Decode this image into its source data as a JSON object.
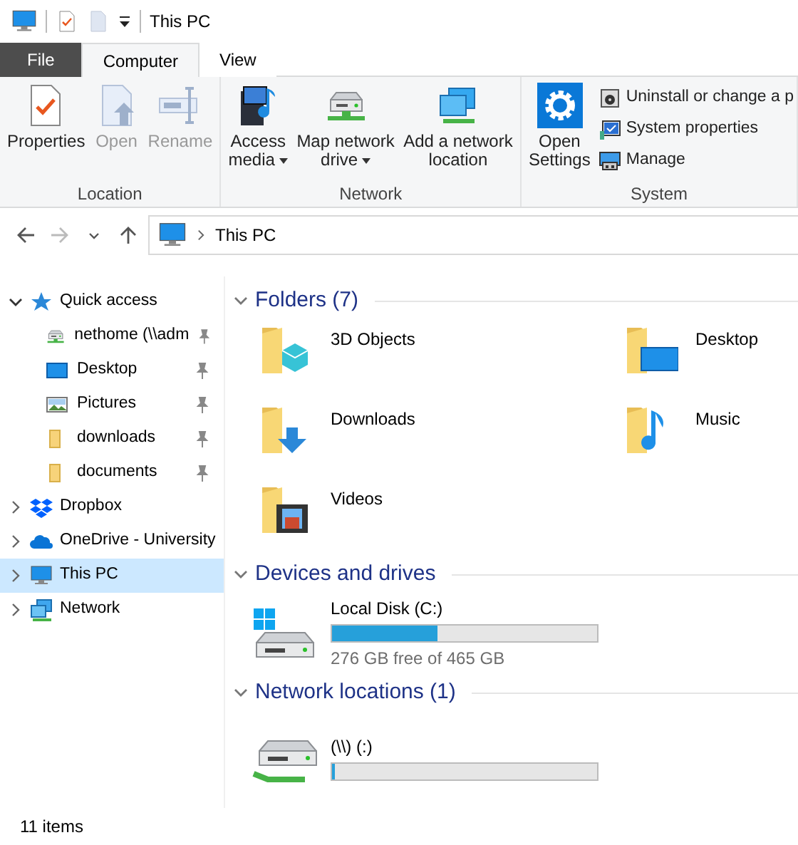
{
  "window": {
    "title": "This PC"
  },
  "tabs": [
    {
      "label": "File",
      "kind": "file",
      "selected": false
    },
    {
      "label": "Computer",
      "kind": "tab",
      "selected": true
    },
    {
      "label": "View",
      "kind": "tab",
      "selected": false
    }
  ],
  "ribbon": {
    "groups": [
      {
        "label": "Location",
        "buttons": [
          {
            "lines": [
              "Properties"
            ],
            "disabled": false,
            "dropdown": false
          },
          {
            "lines": [
              "Open"
            ],
            "disabled": true,
            "dropdown": false
          },
          {
            "lines": [
              "Rename"
            ],
            "disabled": true,
            "dropdown": false
          }
        ]
      },
      {
        "label": "Network",
        "buttons": [
          {
            "lines": [
              "Access",
              "media"
            ],
            "disabled": false,
            "dropdown": true
          },
          {
            "lines": [
              "Map network",
              "drive"
            ],
            "disabled": false,
            "dropdown": true
          },
          {
            "lines": [
              "Add a network",
              "location"
            ],
            "disabled": false,
            "dropdown": false
          }
        ]
      },
      {
        "label": "System",
        "buttons": [
          {
            "lines": [
              "Open",
              "Settings"
            ],
            "disabled": false,
            "dropdown": false
          }
        ],
        "small_buttons": [
          "Uninstall or change a p",
          "System properties",
          "Manage"
        ]
      }
    ]
  },
  "navigation": {
    "back_disabled": false,
    "forward_disabled": true,
    "address": "This PC"
  },
  "sidebar": {
    "items": [
      {
        "label": "Quick access",
        "expanded": true,
        "selected": false,
        "children": [
          {
            "label": "nethome (\\\\adm",
            "pinned": true,
            "selected": false
          },
          {
            "label": "Desktop",
            "pinned": true,
            "selected": false
          },
          {
            "label": "Pictures",
            "pinned": true,
            "selected": false
          },
          {
            "label": "downloads",
            "pinned": true,
            "selected": false
          },
          {
            "label": "documents",
            "pinned": true,
            "selected": false
          }
        ]
      },
      {
        "label": "Dropbox",
        "expanded": false,
        "selected": false
      },
      {
        "label": "OneDrive - University",
        "expanded": false,
        "selected": false
      },
      {
        "label": "This PC",
        "expanded": false,
        "selected": true
      },
      {
        "label": "Network",
        "expanded": false,
        "selected": false
      }
    ]
  },
  "sections": [
    {
      "title": "Folders (7)",
      "kind": "folders",
      "expanded": true,
      "items": [
        {
          "label": "3D Objects"
        },
        {
          "label": "Desktop"
        },
        {
          "label": "Downloads"
        },
        {
          "label": "Music"
        },
        {
          "label": "Videos"
        }
      ]
    },
    {
      "title": "Devices and drives",
      "kind": "drives",
      "expanded": true,
      "items": [
        {
          "label": "Local Disk (C:)",
          "level": 0.4,
          "detail": "276 GB free of 465 GB"
        }
      ]
    },
    {
      "title": "Network locations (1)",
      "kind": "drives",
      "expanded": true,
      "items": [
        {
          "label": "(\\\\) (:)",
          "level": 0.01
        }
      ]
    }
  ],
  "status_bar": {
    "text": "11 items"
  }
}
